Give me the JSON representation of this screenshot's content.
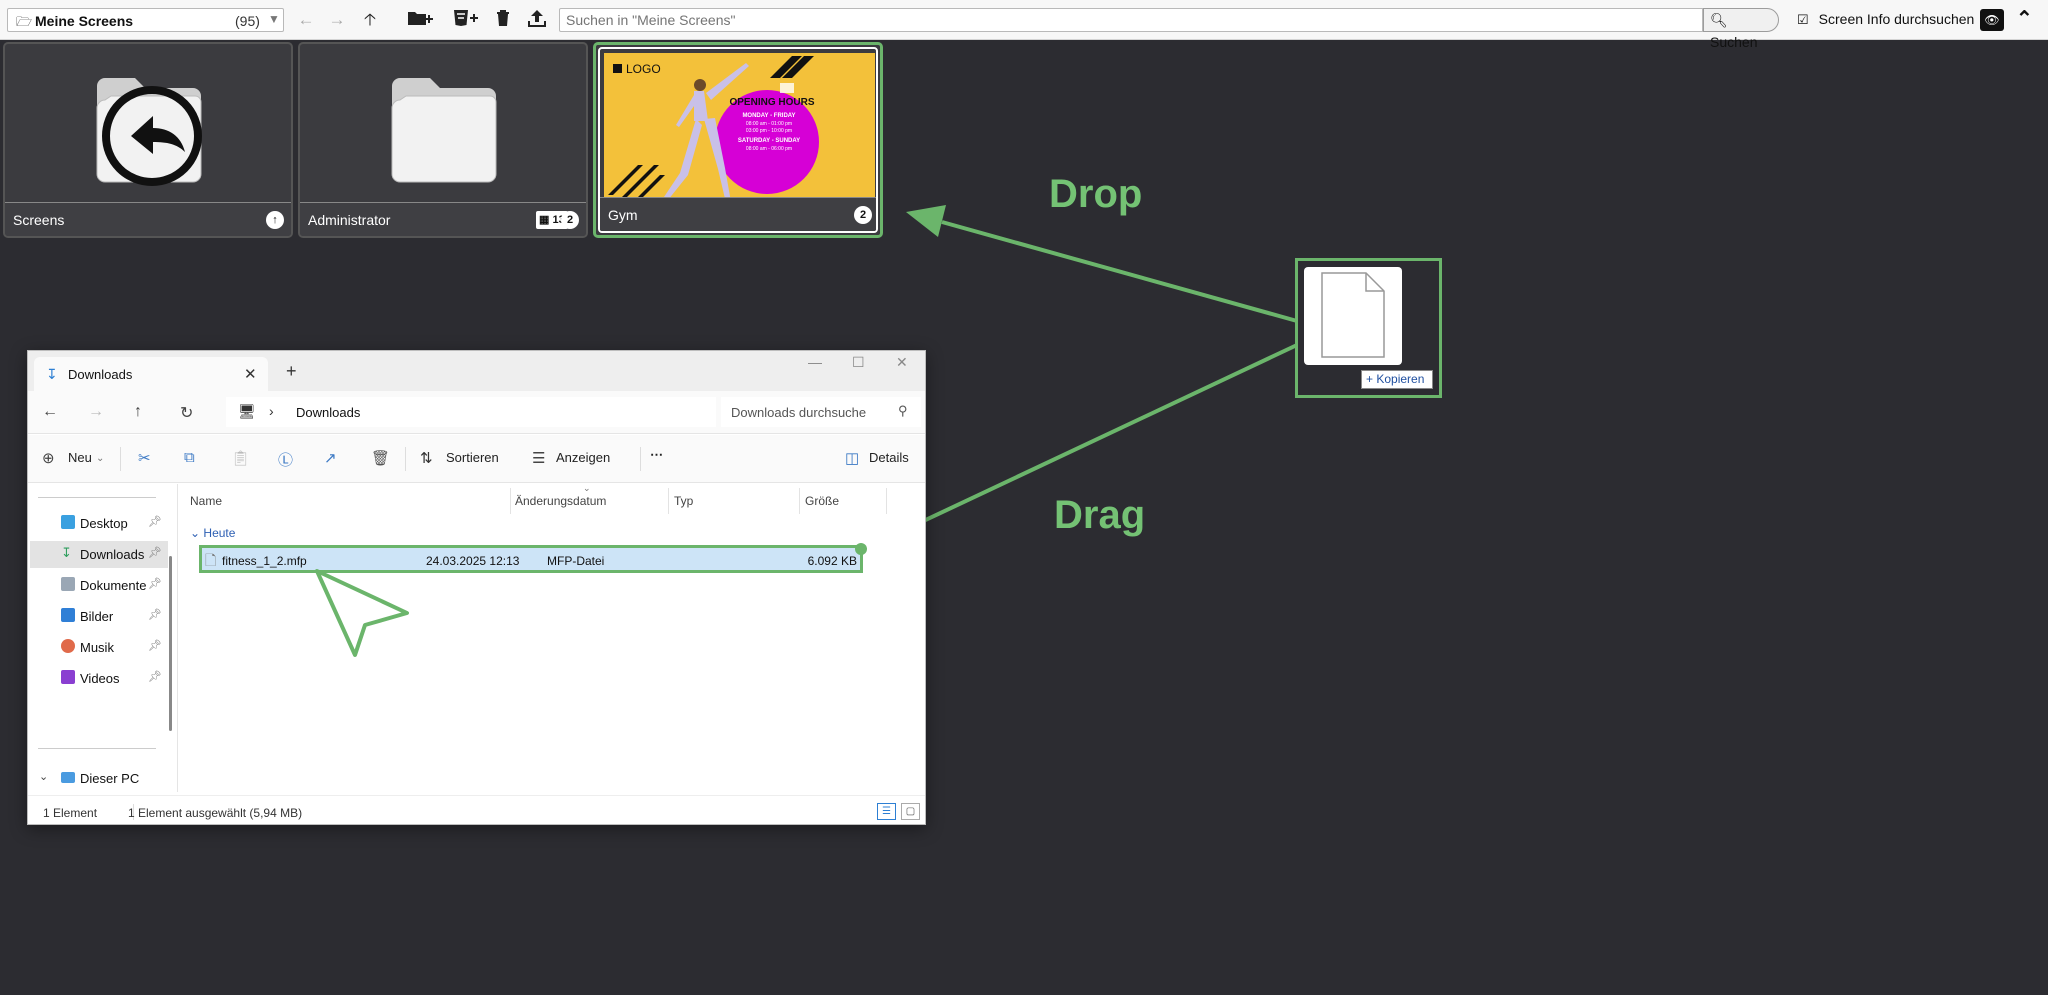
{
  "toolbar": {
    "folder_name": "Meine Screens",
    "folder_count": "(95)",
    "search_placeholder": "Suchen in \"Meine Screens\"",
    "search_button": "Suchen",
    "screen_info_label": "Screen Info durchsuchen"
  },
  "tiles": [
    {
      "label": "Screens"
    },
    {
      "label": "Administrator",
      "badge_folders": "13",
      "badge_count": "2"
    },
    {
      "label": "Gym",
      "badge_count": "2"
    }
  ],
  "gym_thumb": {
    "logo": "LOGO",
    "title": "OPENING HOURS",
    "weekday_label": "MONDAY - FRIDAY",
    "weekday_hours_1": "08:00 am - 01:00 pm",
    "weekday_hours_2": "03:00 pm - 10:00 pm",
    "weekend_label": "SATURDAY - SUNDAY",
    "weekend_hours": "08:00 am - 06:00 pm",
    "accent_color": "#f3c13a",
    "circle_color": "#d600d6"
  },
  "annotations": {
    "drop": "Drop",
    "drag": "Drag",
    "color": "#6bb56b"
  },
  "drag_ghost": {
    "copy_label": "+ Kopieren"
  },
  "explorer": {
    "tab_title": "Downloads",
    "address": "Downloads",
    "search_placeholder": "Downloads durchsuche",
    "commands": {
      "new": "Neu",
      "sort": "Sortieren",
      "view": "Anzeigen",
      "details": "Details"
    },
    "sidebar": [
      {
        "label": "Desktop"
      },
      {
        "label": "Downloads"
      },
      {
        "label": "Dokumente"
      },
      {
        "label": "Bilder"
      },
      {
        "label": "Musik"
      },
      {
        "label": "Videos"
      }
    ],
    "this_pc": "Dieser PC",
    "columns": [
      "Name",
      "Änderungsdatum",
      "Typ",
      "Größe"
    ],
    "group": "Heute",
    "file": {
      "name": "fitness_1_2.mfp",
      "date": "24.03.2025 12:13",
      "type": "MFP-Datei",
      "size": "6.092 KB"
    },
    "status_count": "1 Element",
    "status_selected": "1 Element ausgewählt (5,94 MB)"
  }
}
